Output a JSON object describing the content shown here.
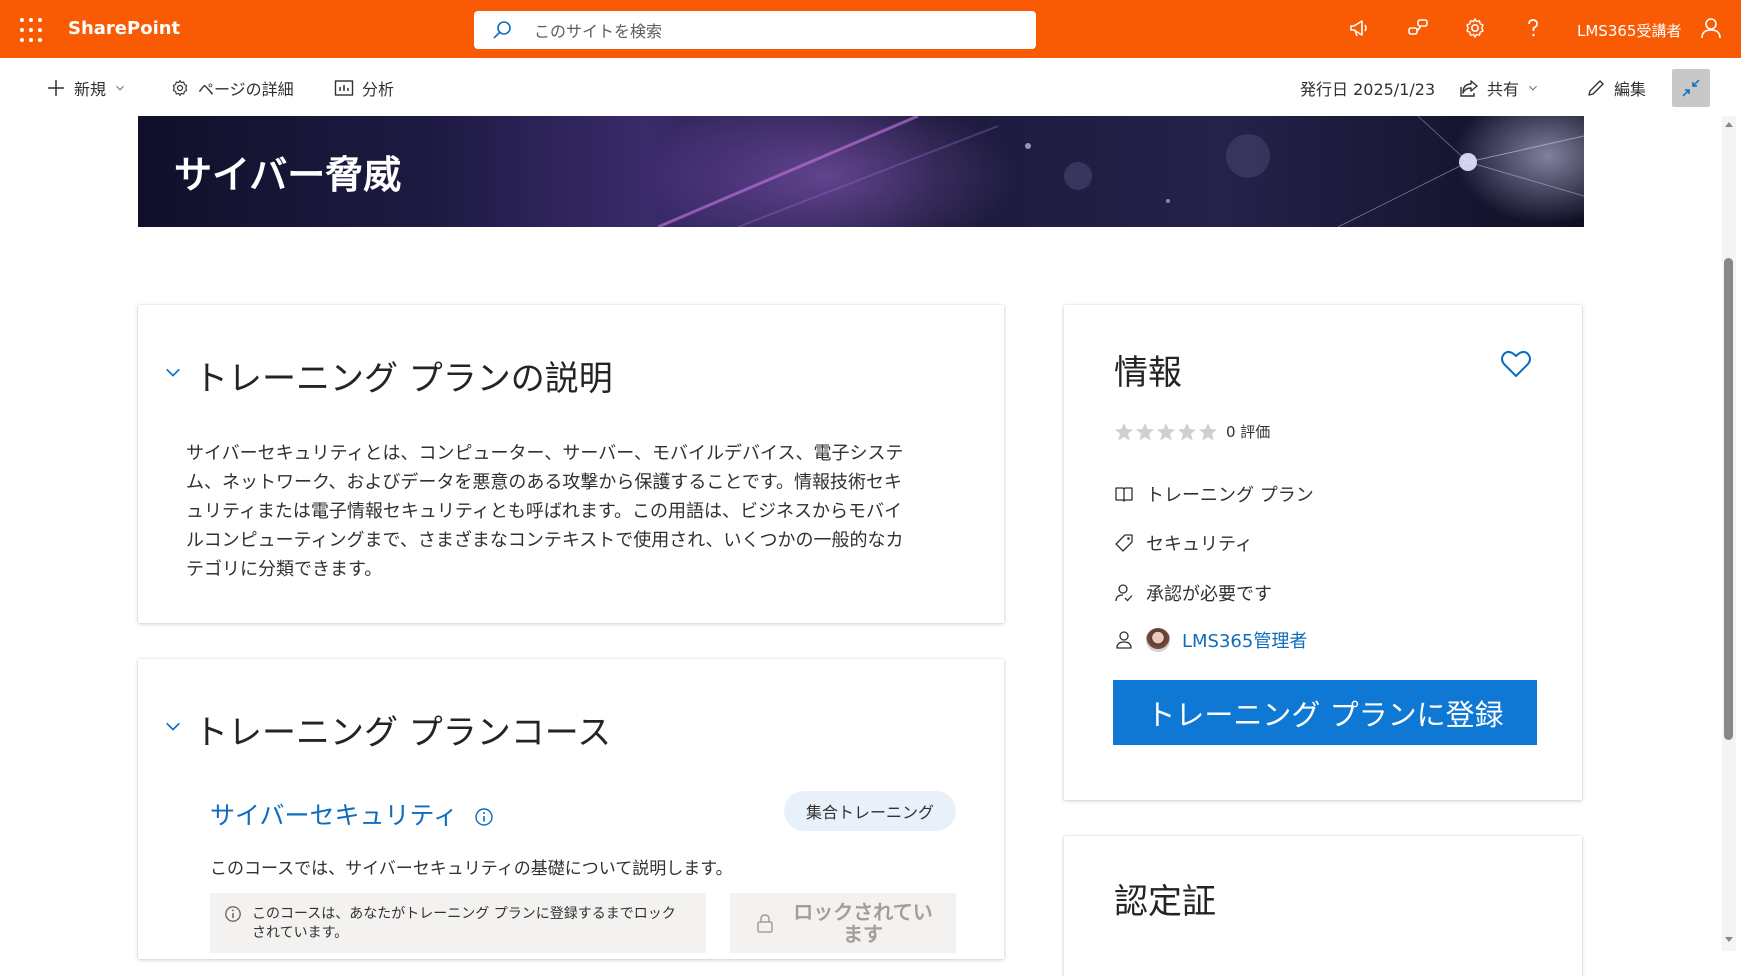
{
  "suitebar": {
    "brand": "SharePoint",
    "search_placeholder": "このサイトを検索",
    "user_name": "LMS365受講者",
    "bg_color": "#f95b04"
  },
  "commandbar": {
    "new_label": "新規",
    "page_details_label": "ページの詳細",
    "analytics_label": "分析",
    "published": "発行日 2025/1/23",
    "share_label": "共有",
    "edit_label": "編集"
  },
  "banner": {
    "title": "サイバー脅威"
  },
  "description_card": {
    "title": "トレーニング プランの説明",
    "lines": [
      "サイバーセキュリティとは、コンピューター、サーバー、モバイルデバイス、電子システ",
      "ム、ネットワーク、およびデータを悪意のある攻撃から保護することです。情報技術セキ",
      "ュリティまたは電子情報セキュリティとも呼ばれます。この用語は、ビジネスからモバイ",
      "ルコンピューティングまで、さまざまなコンテキストで使用され、いくつかの一般的なカ",
      "テゴリに分類できます。"
    ]
  },
  "courses_card": {
    "title": "トレーニング プランコース",
    "course": {
      "name": "サイバーセキュリティ",
      "badge": "集合トレーニング",
      "description": "このコースでは、サイバーセキュリティの基礎について説明します。",
      "lock_line1": "このコースは、あなたがトレーニング プランに登録するまでロック",
      "lock_line2": "されています。",
      "lock_button_line1": "ロックされてい",
      "lock_button_line2": "ます"
    }
  },
  "info_card": {
    "title": "情報",
    "rating_count": "0 評価",
    "rating_stars": 0,
    "rating_max": 5,
    "type": "トレーニング プラン",
    "category": "セキュリティ",
    "approval": "承認が必要です",
    "owner": "LMS365管理者",
    "enroll_button": "トレーニング プランに登録",
    "accent_color": "#0f78d4"
  },
  "certificate_card": {
    "title": "認定証"
  }
}
